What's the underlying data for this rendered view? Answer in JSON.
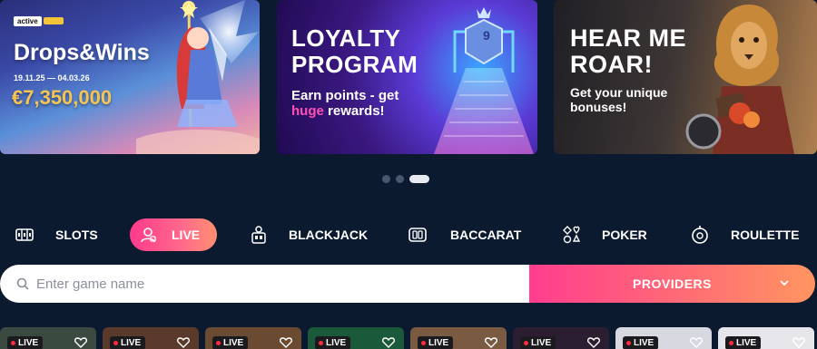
{
  "banners": {
    "drops_wins": {
      "badge": "active",
      "title": "Drops&Wins",
      "dates": "19.11.25 — 04.03.26",
      "amount": "€7,350,000"
    },
    "loyalty": {
      "title_line1": "LOYALTY",
      "title_line2": "PROGRAM",
      "sub_line1": "Earn points - get",
      "sub_highlight": "huge",
      "sub_line2_rest": " rewards!",
      "level_label": "9"
    },
    "roar": {
      "title_line1": "HEAR ME",
      "title_line2": "ROAR!",
      "sub_line1": "Get your unique",
      "sub_line2": "bonuses!"
    }
  },
  "carousel": {
    "slides": 3,
    "active_index": 2
  },
  "categories": [
    {
      "label": "SLOTS",
      "icon": "slot-machine-icon",
      "active": false
    },
    {
      "label": "LIVE",
      "icon": "live-dealer-icon",
      "active": true
    },
    {
      "label": "BLACKJACK",
      "icon": "blackjack-table-icon",
      "active": false
    },
    {
      "label": "BACCARAT",
      "icon": "baccarat-icon",
      "active": false
    },
    {
      "label": "POKER",
      "icon": "card-suits-icon",
      "active": false
    },
    {
      "label": "ROULETTE",
      "icon": "roulette-icon",
      "active": false
    }
  ],
  "search": {
    "placeholder": "Enter game name",
    "value": ""
  },
  "providers": {
    "label": "PROVIDERS"
  },
  "games": [
    {
      "badge": "LIVE",
      "color": "#3a4a40"
    },
    {
      "badge": "LIVE",
      "color": "#5a3a2a"
    },
    {
      "badge": "LIVE",
      "color": "#6a4a30"
    },
    {
      "badge": "LIVE",
      "color": "#1a5a3a"
    },
    {
      "badge": "LIVE",
      "color": "#7a5a40"
    },
    {
      "badge": "LIVE",
      "color": "#2a1e30"
    },
    {
      "badge": "LIVE",
      "color": "#d8d8e0"
    },
    {
      "badge": "LIVE",
      "color": "#e6e6ea"
    }
  ],
  "colors": {
    "background": "#0c1a30",
    "accent_pink": "#ff3a8c",
    "accent_orange": "#ff9560",
    "gold": "#f6c451"
  }
}
